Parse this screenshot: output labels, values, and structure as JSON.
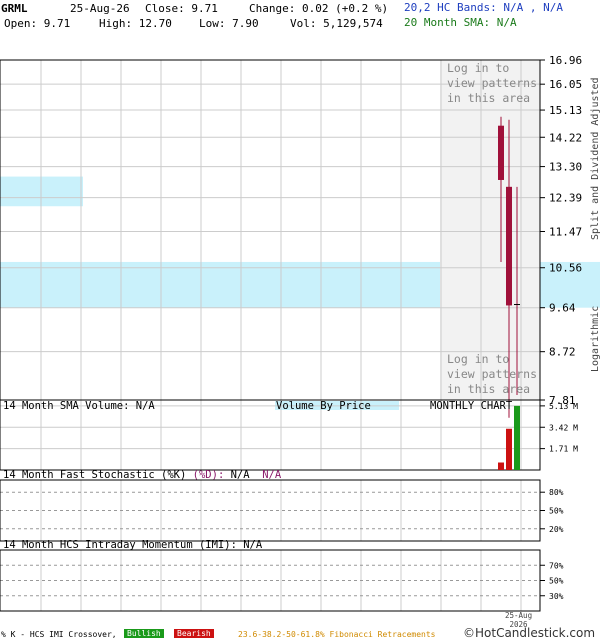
{
  "header": {
    "symbol": "GRML",
    "date": "25-Aug-26",
    "close_label": "Close:",
    "close": "9.71",
    "change_label": "Change:",
    "change": "0.02 (+0.2 %)",
    "open_label": "Open:",
    "open": "9.71",
    "high_label": "High:",
    "high": "12.70",
    "low_label": "Low:",
    "low": "7.90",
    "vol_label": "Vol:",
    "vol": "5,129,574",
    "bands": "20,2 HC Bands: N/A , N/A",
    "sma": "20 Month SMA: N/A"
  },
  "price_panel": {
    "login_text": [
      "Log in to",
      "view patterns",
      "in this area"
    ],
    "side_label_top": "Split and Dividend Adjusted",
    "side_label_bottom": "Logarithmic"
  },
  "volume_panel": {
    "title": "14 Month SMA Volume: N/A",
    "vbp_label": "Volume By Price",
    "chart_type": "MONTHLY CHART"
  },
  "stoch_panel": {
    "title": "14 Month Fast Stochastic (%K)",
    "d_label": "(%D):",
    "k_value": "N/A",
    "d_value": "N/A"
  },
  "imi_panel": {
    "title": "14 Month HCS Intraday Momentum (IMI): N/A"
  },
  "footer": {
    "crossover_label": "% K - HCS IMI Crossover,",
    "bullish": "Bullish",
    "bearish": "Bearish",
    "fib": "23.6-38.2-50-61.8% Fibonacci Retracements",
    "logo": "©HotCandlestick.com",
    "date_label_top": "25-Aug",
    "date_label_bottom": "2026"
  },
  "colors": {
    "bullish": "#1a9a1a",
    "bearish": "#cc1111",
    "candle": "#a0103a",
    "vbp": "#c9f1fb",
    "grid": "#cccccc"
  },
  "chart_data": [
    {
      "type": "candlestick",
      "yscale": "log",
      "y_ticks": [
        16.96,
        16.05,
        15.13,
        14.22,
        13.3,
        12.39,
        11.47,
        10.56,
        9.64,
        8.72,
        7.81
      ],
      "ylim": [
        7.81,
        16.96
      ],
      "candles": [
        {
          "open": 14.6,
          "high": 14.9,
          "low": 10.7,
          "close": 12.9
        },
        {
          "open": 12.7,
          "high": 14.8,
          "low": 7.5,
          "close": 9.69
        },
        {
          "open": 9.71,
          "high": 12.7,
          "low": 7.9,
          "close": 9.71
        }
      ],
      "volume_by_price": [
        {
          "low": 12.15,
          "high": 13.0,
          "volume_fraction": 0.14
        },
        {
          "low": 9.64,
          "high": 10.7,
          "volume_fraction": 1.0
        }
      ]
    },
    {
      "type": "bar",
      "title": "14 Month SMA Volume: N/A",
      "y_ticks": [
        "5.13 M",
        "3.42 M",
        "1.71 M"
      ],
      "ylim": [
        0,
        5.6
      ],
      "values": [
        0.6,
        3.3,
        5.13
      ],
      "colors": [
        "#cc1111",
        "#cc1111",
        "#1a9a1a"
      ]
    },
    {
      "type": "line",
      "title": "14 Month Fast Stochastic (%K)",
      "y_ticks": [
        "80%",
        "50%",
        "20%"
      ],
      "values": []
    },
    {
      "type": "line",
      "title": "14 Month HCS Intraday Momentum (IMI): N/A",
      "y_ticks": [
        "70%",
        "50%",
        "30%"
      ],
      "values": []
    }
  ]
}
